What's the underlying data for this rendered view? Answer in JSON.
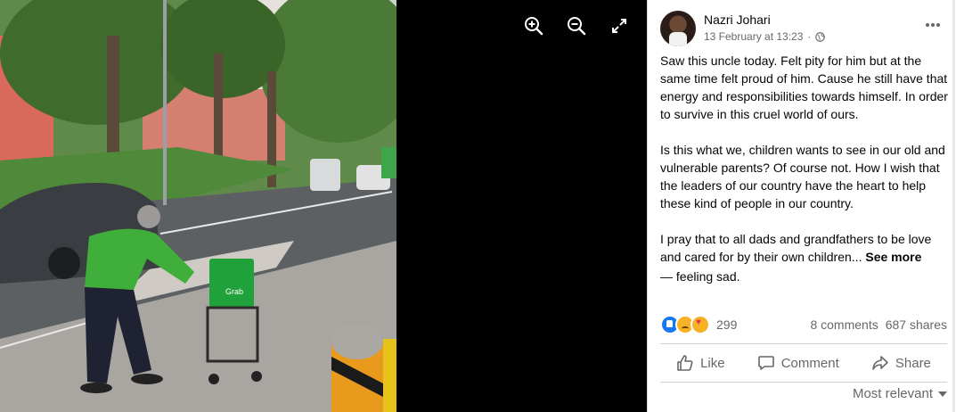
{
  "viewer": {
    "tools": [
      {
        "icon": "zoom-in-icon"
      },
      {
        "icon": "zoom-out-icon"
      },
      {
        "icon": "fullscreen-icon"
      }
    ],
    "photo_text": {
      "bag_logo": "Grab"
    }
  },
  "post": {
    "author": "Nazri Johari",
    "date": "13 February at 13:23",
    "separator": "·",
    "privacy_icon": "globe-icon",
    "paragraphs": [
      "Saw this uncle today. Felt pity for him but at the same time felt proud of him. Cause he still have that energy and responsibilities towards himself. In order to survive in this cruel world of ours.",
      "Is this what we, children wants to see in our old and vulnerable parents? Of course not. How I wish that the leaders of our country have the heart to help these kind of people in our country.",
      "I pray that to all dads and grandfathers to be love and cared for by their own children..."
    ],
    "see_more": "See more",
    "feeling": "— feeling sad."
  },
  "stats": {
    "reaction_count": "299",
    "comments": "8 comments",
    "shares": "687 shares"
  },
  "actions": {
    "like": "Like",
    "comment": "Comment",
    "share": "Share"
  },
  "sort": {
    "label": "Most relevant"
  },
  "colors": {
    "accent": "#1877f2",
    "text": "#050505",
    "secondary": "#65676b"
  }
}
